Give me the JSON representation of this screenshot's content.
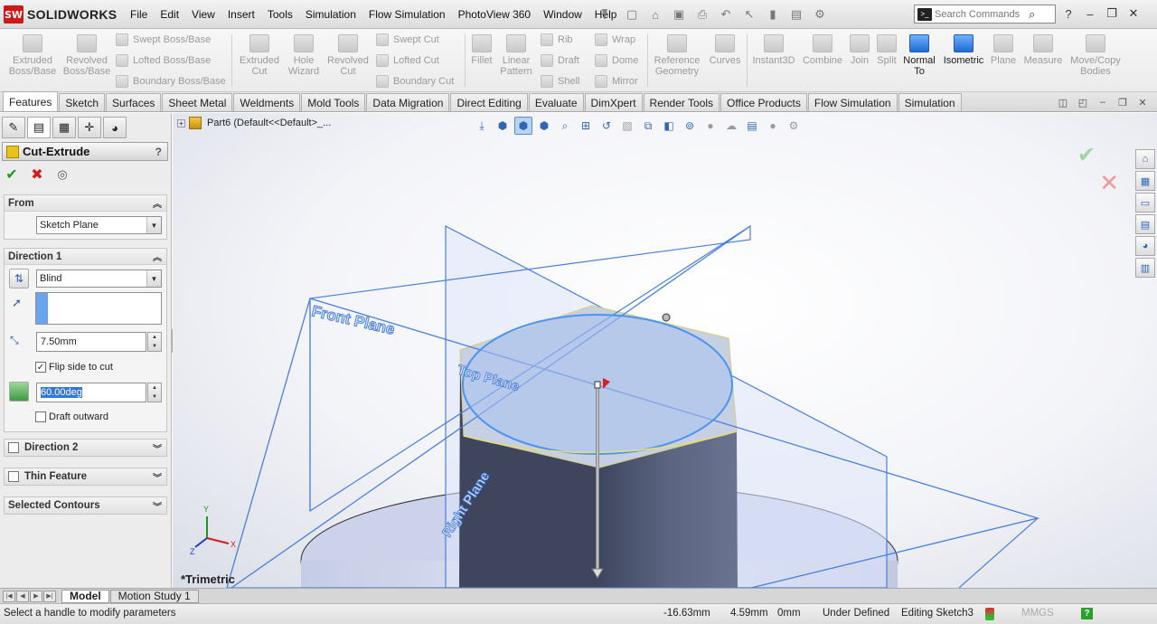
{
  "app": {
    "brand_mark": "SW",
    "brand_name": "SOLIDWORKS"
  },
  "menu": [
    "File",
    "Edit",
    "View",
    "Insert",
    "Tools",
    "Simulation",
    "Flow Simulation",
    "PhotoView 360",
    "Window",
    "Help"
  ],
  "search": {
    "placeholder": "Search Commands"
  },
  "commands": {
    "extruded_boss": "Extruded Boss/Base",
    "revolved_boss": "Revolved Boss/Base",
    "swept_boss": "Swept Boss/Base",
    "lofted_boss": "Lofted Boss/Base",
    "boundary_boss": "Boundary Boss/Base",
    "extruded_cut": "Extruded Cut",
    "hole_wizard": "Hole Wizard",
    "revolved_cut": "Revolved Cut",
    "swept_cut": "Swept Cut",
    "lofted_cut": "Lofted Cut",
    "boundary_cut": "Boundary Cut",
    "fillet": "Fillet",
    "linear_pattern": "Linear Pattern",
    "rib": "Rib",
    "draft": "Draft",
    "shell": "Shell",
    "wrap": "Wrap",
    "dome": "Dome",
    "mirror": "Mirror",
    "reference_geometry": "Reference Geometry",
    "curves": "Curves",
    "instant3d": "Instant3D",
    "combine": "Combine",
    "join": "Join",
    "split": "Split",
    "normal_to": "Normal To",
    "isometric": "Isometric",
    "plane": "Plane",
    "measure": "Measure",
    "move_copy": "Move/Copy Bodies"
  },
  "tabs": [
    "Features",
    "Sketch",
    "Surfaces",
    "Sheet Metal",
    "Weldments",
    "Mold Tools",
    "Data Migration",
    "Direct Editing",
    "Evaluate",
    "DimXpert",
    "Render Tools",
    "Office Products",
    "Flow Simulation",
    "Simulation"
  ],
  "property_manager": {
    "title": "Cut-Extrude",
    "help": "?",
    "from": {
      "header": "From",
      "value": "Sketch Plane"
    },
    "direction1": {
      "header": "Direction 1",
      "end_condition": "Blind",
      "depth": "7.50mm",
      "flip_label": "Flip side to cut",
      "draft_angle": "60.00deg",
      "draft_outward_label": "Draft outward"
    },
    "direction2": {
      "header": "Direction 2"
    },
    "thin_feature": {
      "header": "Thin Feature"
    },
    "selected_contours": {
      "header": "Selected Contours"
    }
  },
  "viewport": {
    "tree_label": "Part6  (Default<<Default>_...",
    "view_label": "*Trimetric",
    "planes": {
      "front": "Front Plane",
      "top": "Top Plane",
      "right": "Right Plane"
    },
    "triad": {
      "x": "X",
      "y": "Y",
      "z": "Z"
    }
  },
  "bottom_tabs": [
    "Model",
    "Motion Study 1"
  ],
  "status": {
    "message": "Select a handle to modify parameters",
    "x": "-16.63mm",
    "y": "4.59mm",
    "z": "0mm",
    "state": "Under Defined",
    "editing": "Editing Sketch3",
    "units": "MMGS"
  },
  "colors": {
    "accent": "#3b78e7",
    "plane": "#4a7fdc",
    "body_top": "#b8c6ec",
    "body_side": "#4d5672"
  }
}
